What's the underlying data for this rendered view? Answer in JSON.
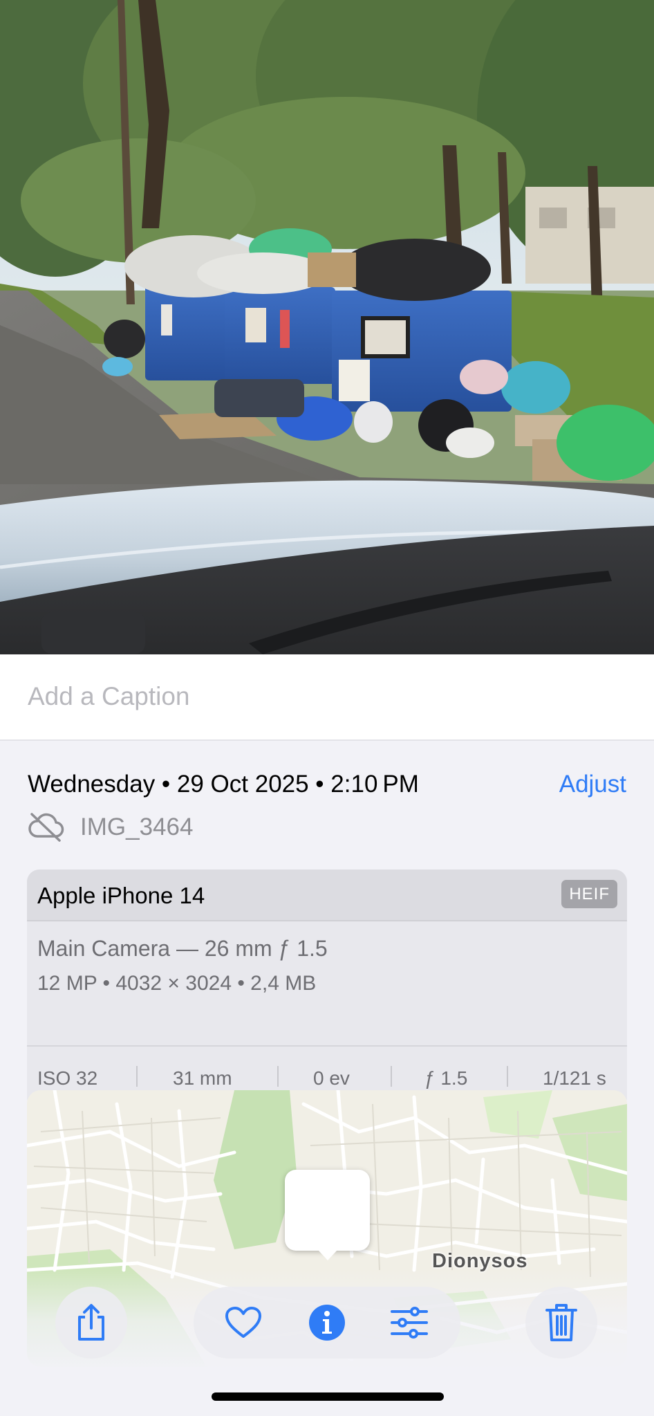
{
  "caption": {
    "placeholder": "Add a Caption"
  },
  "info": {
    "date": "Wednesday • 29 Oct 2025 • 2:10 PM",
    "adjust_label": "Adjust",
    "filename": "IMG_3464",
    "file_icon": "cloud-slash-icon"
  },
  "camera": {
    "model": "Apple iPhone 14",
    "format": "HEIF",
    "lens": "Main Camera — 26 mm ƒ 1.5",
    "specs": "12 MP • 4032 × 3024 • 2,4 MB",
    "exif": {
      "iso": "ISO 32",
      "focal": "31 mm",
      "ev": "0 ev",
      "aperture": "ƒ 1.5",
      "shutter": "1/121 s"
    }
  },
  "map": {
    "place": "Dionysos"
  },
  "toolbar": {
    "share": "share-icon",
    "favorite": "heart-icon",
    "info": "info-icon",
    "edit": "adjustments-icon",
    "delete": "trash-icon"
  },
  "colors": {
    "accent": "#2f7cf6",
    "secondary_text": "#8e8e93",
    "background": "#f2f2f7"
  }
}
